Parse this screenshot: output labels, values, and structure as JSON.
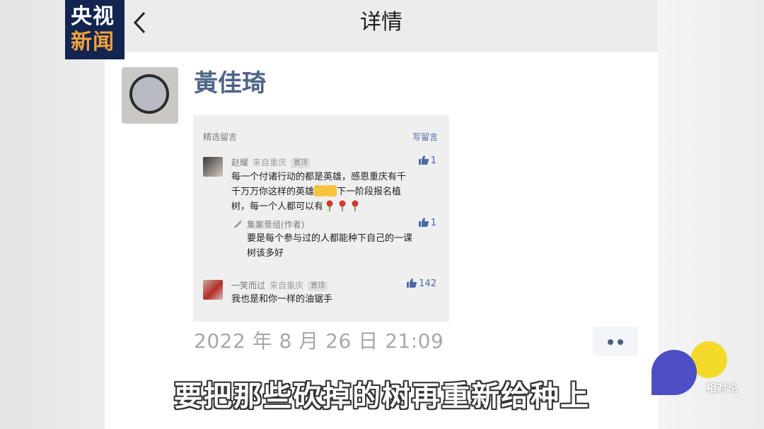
{
  "watermark": {
    "line1": "央视",
    "line2": "新闻"
  },
  "nav": {
    "title": "详情",
    "back_icon": "chevron-left-icon"
  },
  "post": {
    "author": "黃佳琦",
    "timestamp": "2022 年 8 月 26 日 21:09"
  },
  "comments_card": {
    "header_label": "精选留言",
    "write_label": "写留言",
    "comments": [
      {
        "name": "赵耀",
        "location": "来自重庆",
        "tag": "置顶",
        "likes": "1",
        "text_line1": "每一个付诸行动的都是英雄，感恩重庆有千",
        "text_line2a": "千万万你这样的英雄",
        "text_line2b": "下一阶段报名植",
        "text_line3": "树，每一个人都可以有",
        "reply": {
          "name": "集案景组(作者)",
          "likes": "1",
          "text_line1": "要是每个参与过的人都能种下自己的一课",
          "text_line2": "树该多好"
        }
      },
      {
        "name": "一笑而过",
        "location": "来自重庆",
        "tag": "置顶",
        "likes": "142",
        "text_line1": "我也是和你一样的油锯手"
      }
    ]
  },
  "subtitle": "要把那些砍掉的树再重新给种上",
  "brand": {
    "label": "相对论"
  },
  "colors": {
    "accent": "#4a6aa6",
    "author": "#4f6488",
    "logo_bg": "#12244f",
    "logo_accent": "#f2a23c"
  }
}
